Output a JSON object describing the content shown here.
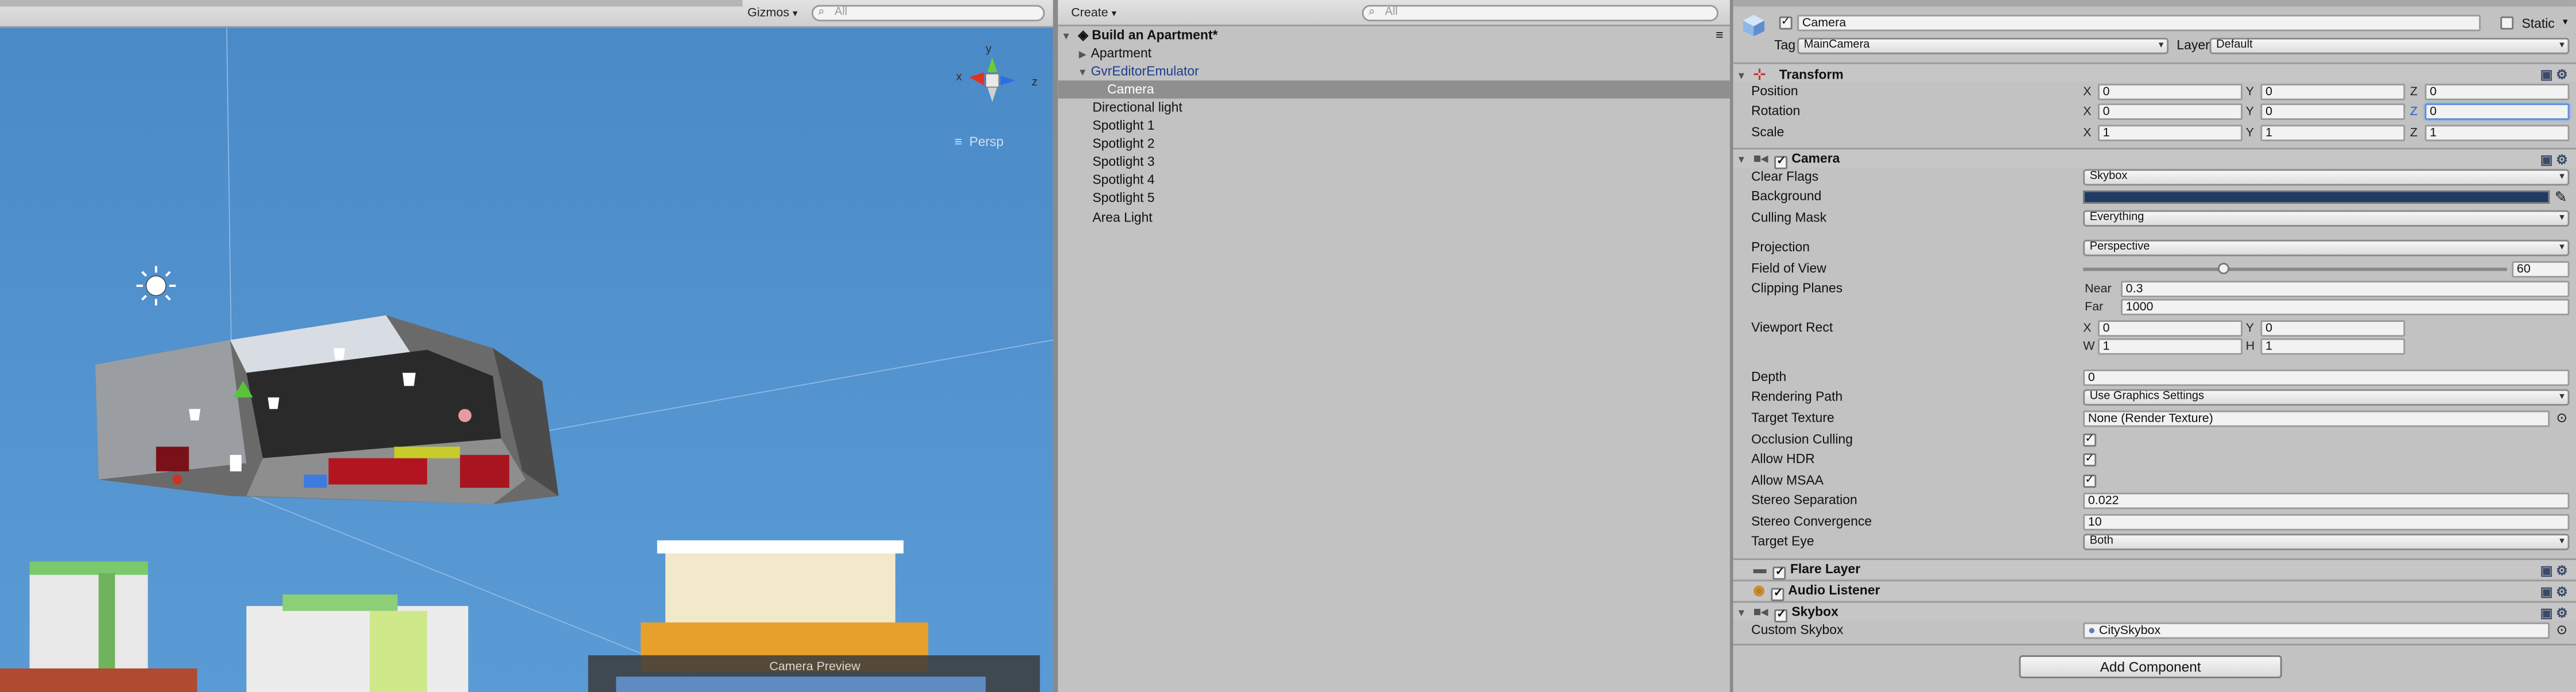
{
  "scene_view": {
    "gizmos_label": "Gizmos",
    "search_placeholder": "All",
    "persp_label": "Persp",
    "camera_preview_label": "Camera Preview",
    "gizmo_axis_x": "x",
    "gizmo_axis_y": "y",
    "gizmo_axis_z": "z",
    "sky_color": "#4d8dc9"
  },
  "hierarchy": {
    "create_label": "Create",
    "search_placeholder": "All",
    "scene_name": "Build an Apartment*",
    "items": [
      {
        "label": "Apartment",
        "indent": 1,
        "expander": "right"
      },
      {
        "label": "GvrEditorEmulator",
        "indent": 1,
        "expander": "down",
        "prefab": true
      },
      {
        "label": "Camera",
        "indent": 2,
        "selected": true
      },
      {
        "label": "Directional light",
        "indent": 1
      },
      {
        "label": "Spotlight 1",
        "indent": 1
      },
      {
        "label": "Spotlight 2",
        "indent": 1
      },
      {
        "label": "Spotlight 3",
        "indent": 1
      },
      {
        "label": "Spotlight 4",
        "indent": 1
      },
      {
        "label": "Spotlight 5",
        "indent": 1
      },
      {
        "label": "Area Light",
        "indent": 1
      }
    ]
  },
  "inspector": {
    "object_name": "Camera",
    "static_label": "Static",
    "tag_label": "Tag",
    "tag_value": "MainCamera",
    "layer_label": "Layer",
    "layer_value": "Default",
    "transform": {
      "title": "Transform",
      "position_label": "Position",
      "rotation_label": "Rotation",
      "scale_label": "Scale",
      "position": {
        "x": "0",
        "y": "0",
        "z": "0"
      },
      "rotation": {
        "x": "0",
        "y": "0",
        "z": "0"
      },
      "scale": {
        "x": "1",
        "y": "1",
        "z": "1"
      }
    },
    "camera": {
      "title": "Camera",
      "clear_flags_label": "Clear Flags",
      "clear_flags_value": "Skybox",
      "background_label": "Background",
      "background_color": "#1f3a63",
      "culling_mask_label": "Culling Mask",
      "culling_mask_value": "Everything",
      "projection_label": "Projection",
      "projection_value": "Perspective",
      "fov_label": "Field of View",
      "fov_value": "60",
      "fov_fraction": 0.33,
      "clipping_label": "Clipping Planes",
      "near_label": "Near",
      "near_value": "0.3",
      "far_label": "Far",
      "far_value": "1000",
      "viewport_label": "Viewport Rect",
      "vp_x": "0",
      "vp_y": "0",
      "vp_w": "1",
      "vp_h": "1",
      "depth_label": "Depth",
      "depth_value": "0",
      "rendering_path_label": "Rendering Path",
      "rendering_path_value": "Use Graphics Settings",
      "target_texture_label": "Target Texture",
      "target_texture_value": "None (Render Texture)",
      "occlusion_label": "Occlusion Culling",
      "hdr_label": "Allow HDR",
      "msaa_label": "Allow MSAA",
      "stereo_sep_label": "Stereo Separation",
      "stereo_sep_value": "0.022",
      "stereo_conv_label": "Stereo Convergence",
      "stereo_conv_value": "10",
      "target_eye_label": "Target Eye",
      "target_eye_value": "Both"
    },
    "flare_layer_title": "Flare Layer",
    "audio_listener_title": "Audio Listener",
    "skybox": {
      "title": "Skybox",
      "custom_label": "Custom Skybox",
      "custom_value": "CitySkybox"
    },
    "add_component_label": "Add Component"
  }
}
